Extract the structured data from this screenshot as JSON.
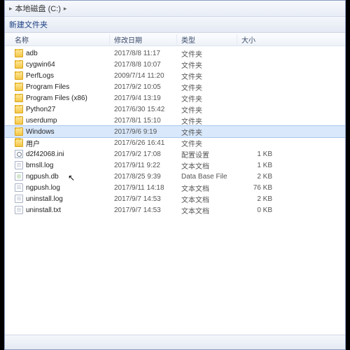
{
  "breadcrumb": {
    "sep": "▸",
    "loc": "本地磁盘 (C:)",
    "tail": "▸"
  },
  "toolbar": {
    "newfolder": "新建文件夹"
  },
  "columns": {
    "name": "名称",
    "date": "修改日期",
    "type": "类型",
    "size": "大小"
  },
  "rows": [
    {
      "icon": "folder",
      "name": "adb",
      "date": "2017/8/8 11:17",
      "type": "文件夹",
      "size": "",
      "sel": false
    },
    {
      "icon": "folder",
      "name": "cygwin64",
      "date": "2017/8/8 10:07",
      "type": "文件夹",
      "size": "",
      "sel": false
    },
    {
      "icon": "folder",
      "name": "PerfLogs",
      "date": "2009/7/14 11:20",
      "type": "文件夹",
      "size": "",
      "sel": false
    },
    {
      "icon": "folder",
      "name": "Program Files",
      "date": "2017/9/2 10:05",
      "type": "文件夹",
      "size": "",
      "sel": false
    },
    {
      "icon": "folder",
      "name": "Program Files (x86)",
      "date": "2017/9/4 13:19",
      "type": "文件夹",
      "size": "",
      "sel": false
    },
    {
      "icon": "folder",
      "name": "Python27",
      "date": "2017/6/30 15:42",
      "type": "文件夹",
      "size": "",
      "sel": false
    },
    {
      "icon": "folder",
      "name": "userdump",
      "date": "2017/8/1 15:10",
      "type": "文件夹",
      "size": "",
      "sel": false
    },
    {
      "icon": "folder",
      "name": "Windows",
      "date": "2017/9/6 9:19",
      "type": "文件夹",
      "size": "",
      "sel": true
    },
    {
      "icon": "folder",
      "name": "用户",
      "date": "2017/6/26 16:41",
      "type": "文件夹",
      "size": "",
      "sel": false
    },
    {
      "icon": "ini",
      "name": "d2f42068.ini",
      "date": "2017/9/2 17:08",
      "type": "配置设置",
      "size": "1 KB",
      "sel": false
    },
    {
      "icon": "file",
      "name": "bmsll.log",
      "date": "2017/9/11 9:22",
      "type": "文本文档",
      "size": "1 KB",
      "sel": false
    },
    {
      "icon": "db",
      "name": "ngpush.db",
      "date": "2017/8/25 9:39",
      "type": "Data Base File",
      "size": "2 KB",
      "sel": false
    },
    {
      "icon": "file",
      "name": "ngpush.log",
      "date": "2017/9/11 14:18",
      "type": "文本文档",
      "size": "76 KB",
      "sel": false
    },
    {
      "icon": "file",
      "name": "uninstall.log",
      "date": "2017/9/7 14:53",
      "type": "文本文档",
      "size": "2 KB",
      "sel": false
    },
    {
      "icon": "file",
      "name": "uninstall.txt",
      "date": "2017/9/7 14:53",
      "type": "文本文档",
      "size": "0 KB",
      "sel": false
    }
  ]
}
